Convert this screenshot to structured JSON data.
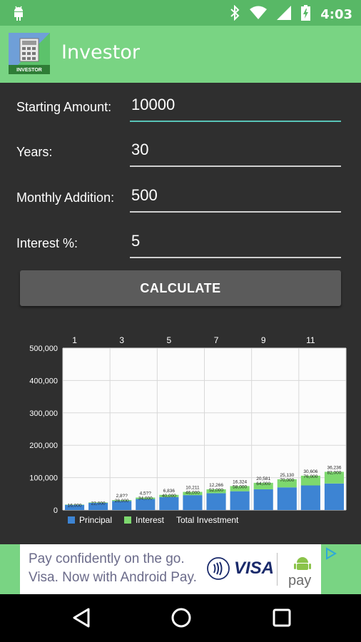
{
  "status_bar": {
    "time": "4:03"
  },
  "app_bar": {
    "title": "Investor",
    "icon_label": "INVESTOR"
  },
  "form": {
    "starting_amount_label": "Starting Amount:",
    "starting_amount_value": "10000",
    "years_label": "Years:",
    "years_value": "30",
    "monthly_addition_label": "Monthly Addition:",
    "monthly_addition_value": "500",
    "interest_label": "Interest %:",
    "interest_value": "5"
  },
  "calculate_label": "CALCULATE",
  "colors": {
    "principal": "#3d84d3",
    "interest": "#7dd86e",
    "accent": "#58c3b7"
  },
  "chart_data": {
    "type": "bar",
    "stacked": true,
    "x_ticks": [
      "1",
      "3",
      "5",
      "7",
      "9",
      "11"
    ],
    "y_ticks": [
      "500,000",
      "400,000",
      "300,000",
      "200,000",
      "100,000",
      "0"
    ],
    "ylim": [
      0,
      500000
    ],
    "categories": [
      1,
      2,
      3,
      4,
      5,
      6,
      7,
      8,
      9,
      10,
      11,
      12
    ],
    "series": [
      {
        "name": "Principal",
        "values": [
          16000,
          22000,
          28000,
          34000,
          40000,
          46000,
          52000,
          58000,
          64000,
          70000,
          76000,
          82000
        ]
      },
      {
        "name": "Interest",
        "values": [
          1000,
          1500,
          2800,
          4500,
          6800,
          10000,
          12000,
          16000,
          20000,
          25000,
          30000,
          36000
        ]
      }
    ],
    "bar_labels": [
      {
        "interest": "",
        "principal": "16,000"
      },
      {
        "interest": "",
        "principal": "22,000"
      },
      {
        "interest": "2,8??",
        "principal": "28,000"
      },
      {
        "interest": "4,5??",
        "principal": "34,000"
      },
      {
        "interest": "6,836",
        "principal": "40,000"
      },
      {
        "interest": "10,211",
        "principal": "46,000"
      },
      {
        "interest": "12,266",
        "principal": "52,000"
      },
      {
        "interest": "16,324",
        "principal": "58,000"
      },
      {
        "interest": "20,581",
        "principal": "64,000"
      },
      {
        "interest": "25,130",
        "principal": "70,000"
      },
      {
        "interest": "30,606",
        "principal": "76,000"
      },
      {
        "interest": "36,236",
        "principal": "82,000"
      }
    ],
    "legend": [
      "Principal",
      "Interest",
      "Total Investment"
    ],
    "legend_position": "bottom-left",
    "grid": true
  },
  "ad": {
    "line1": "Pay confidently on the go.",
    "line2": "Visa. Now with Android Pay.",
    "visa_text": "VISA",
    "pay_text": "pay"
  }
}
